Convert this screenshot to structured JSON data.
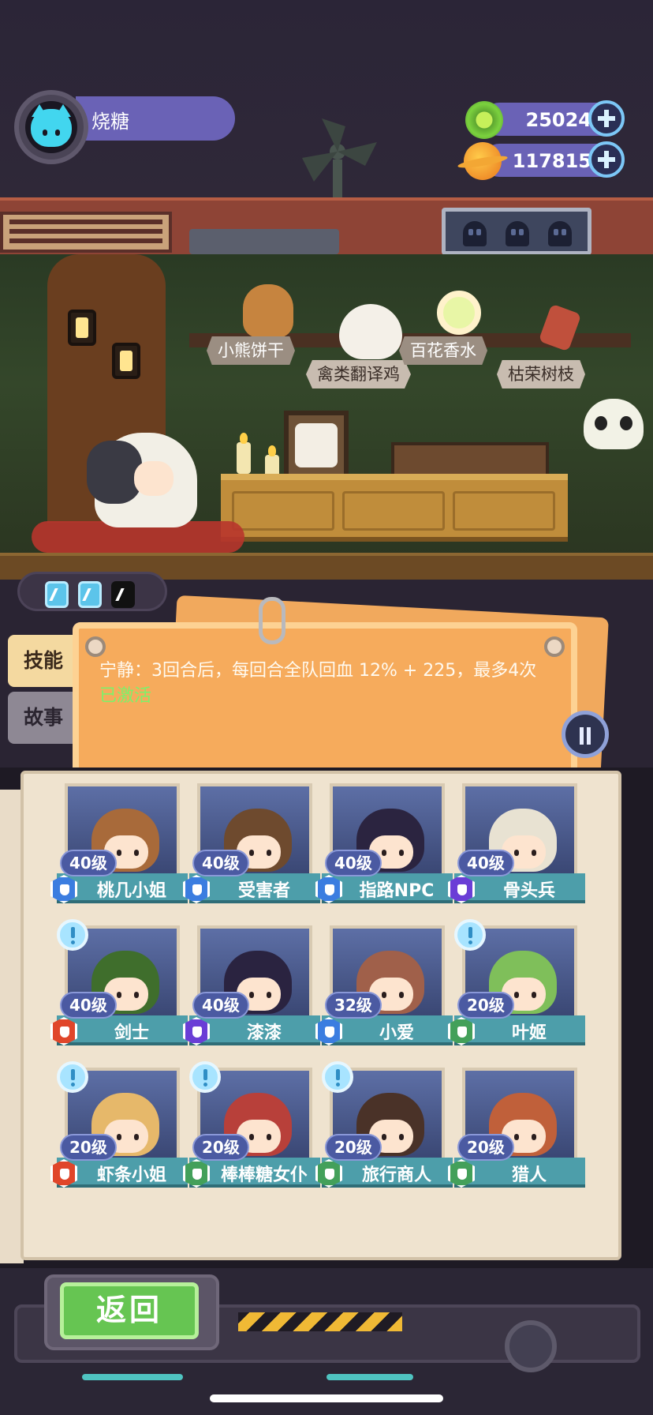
{
  "player": {
    "name": "烧糖"
  },
  "resources": [
    {
      "icon": "green-gem-coin-icon",
      "value": "25024"
    },
    {
      "icon": "orange-planet-coin-icon",
      "value": "117815"
    }
  ],
  "shelf_items": [
    {
      "label": "小熊饼干"
    },
    {
      "label": "禽类翻译鸡"
    },
    {
      "label": "百花香水"
    },
    {
      "label": "枯荣树枝"
    }
  ],
  "charges": {
    "filled": 2,
    "total": 3
  },
  "side_tabs": {
    "skill": "技能",
    "story": "故事"
  },
  "skill": {
    "description": "宁静：3回合后，每回合全队回血 12% + 225，最多4次",
    "status": "已激活"
  },
  "characters": [
    {
      "name": "桃几小姐",
      "level": "40级",
      "badge": "blue",
      "alert": false
    },
    {
      "name": "受害者",
      "level": "40级",
      "badge": "blue",
      "alert": false
    },
    {
      "name": "指路NPC",
      "level": "40级",
      "badge": "blue",
      "alert": false
    },
    {
      "name": "骨头兵",
      "level": "40级",
      "badge": "purple",
      "alert": false
    },
    {
      "name": "剑士",
      "level": "40级",
      "badge": "red",
      "alert": true
    },
    {
      "name": "漆漆",
      "level": "40级",
      "badge": "purple",
      "alert": false
    },
    {
      "name": "小爱",
      "level": "32级",
      "badge": "blue",
      "alert": false
    },
    {
      "name": "叶姬",
      "level": "20级",
      "badge": "green",
      "alert": true
    },
    {
      "name": "虾条小姐",
      "level": "20级",
      "badge": "red",
      "alert": true
    },
    {
      "name": "棒棒糖女仆",
      "level": "20级",
      "badge": "green",
      "alert": true
    },
    {
      "name": "旅行商人",
      "level": "20级",
      "badge": "green",
      "alert": true
    },
    {
      "name": "猎人",
      "level": "20级",
      "badge": "green",
      "alert": false
    }
  ],
  "footer": {
    "back_label": "返回"
  },
  "colors": {
    "accent_purple": "#6a62b6",
    "card_orange": "#f6ab5c",
    "name_bar_teal": "#4d9eaa",
    "back_green": "#66c552",
    "status_green": "#7cf26a"
  }
}
